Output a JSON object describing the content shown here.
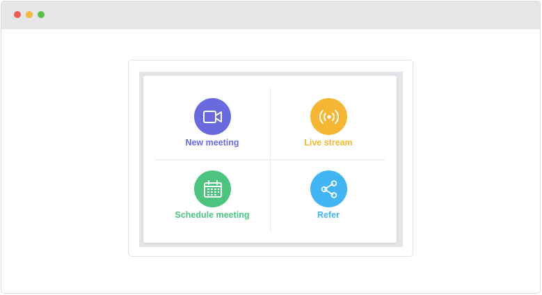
{
  "window": {
    "controls": {
      "close_color": "#ed5b55",
      "minimize_color": "#f2b93d",
      "maximize_color": "#5bbf4a"
    }
  },
  "actions": [
    {
      "label": "New meeting",
      "icon": "video-camera-icon",
      "color": "#6a6adf"
    },
    {
      "label": "Live stream",
      "icon": "broadcast-icon",
      "color": "#f5b733"
    },
    {
      "label": "Schedule meeting",
      "icon": "calendar-icon",
      "color": "#4cc480"
    },
    {
      "label": "Refer",
      "icon": "share-icon",
      "color": "#41b5f4"
    }
  ]
}
